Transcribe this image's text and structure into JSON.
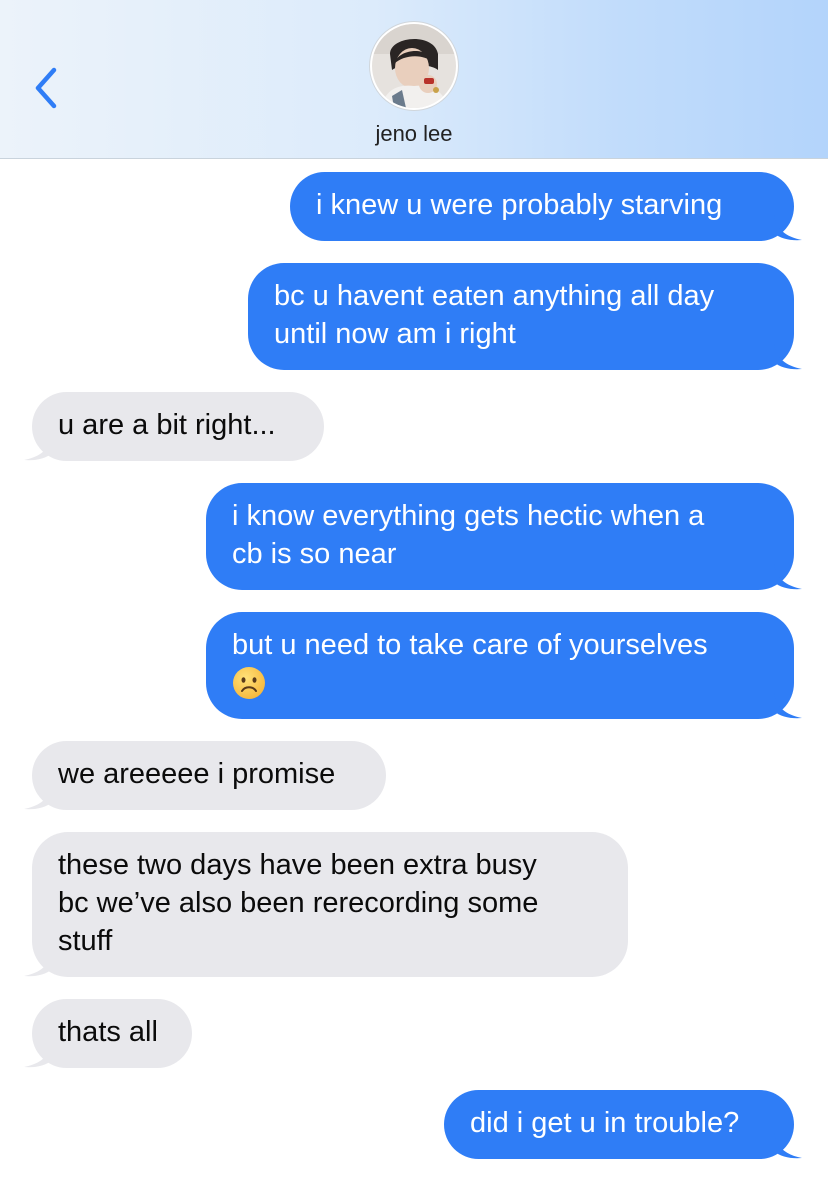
{
  "header": {
    "contact_name": "jeno lee",
    "avatar_icon": "contact-avatar-photo",
    "back_icon": "chevron-left-icon"
  },
  "colors": {
    "sent_bubble": "#2f7df6",
    "received_bubble": "#e8e8ec",
    "accent": "#2f7df6"
  },
  "messages": [
    {
      "direction": "sent",
      "lines": [
        "i knew u were probably starving"
      ]
    },
    {
      "direction": "sent",
      "lines": [
        "bc u havent eaten anything all day",
        "until now am i right"
      ]
    },
    {
      "direction": "received",
      "lines": [
        "u are a bit right..."
      ]
    },
    {
      "direction": "sent",
      "lines": [
        "i know everything gets hectic when a",
        "cb is so near"
      ]
    },
    {
      "direction": "sent",
      "lines": [
        "but u need to take care of yourselves",
        "☹"
      ],
      "emoji": "frowning-face-emoji"
    },
    {
      "direction": "received",
      "lines": [
        "we areeeee i promise"
      ]
    },
    {
      "direction": "received",
      "lines": [
        "these two days have been extra busy",
        "bc we’ve also been rerecording some",
        "stuff"
      ]
    },
    {
      "direction": "received",
      "lines": [
        "thats all"
      ]
    },
    {
      "direction": "sent",
      "lines": [
        "did i get u in trouble?"
      ]
    }
  ]
}
